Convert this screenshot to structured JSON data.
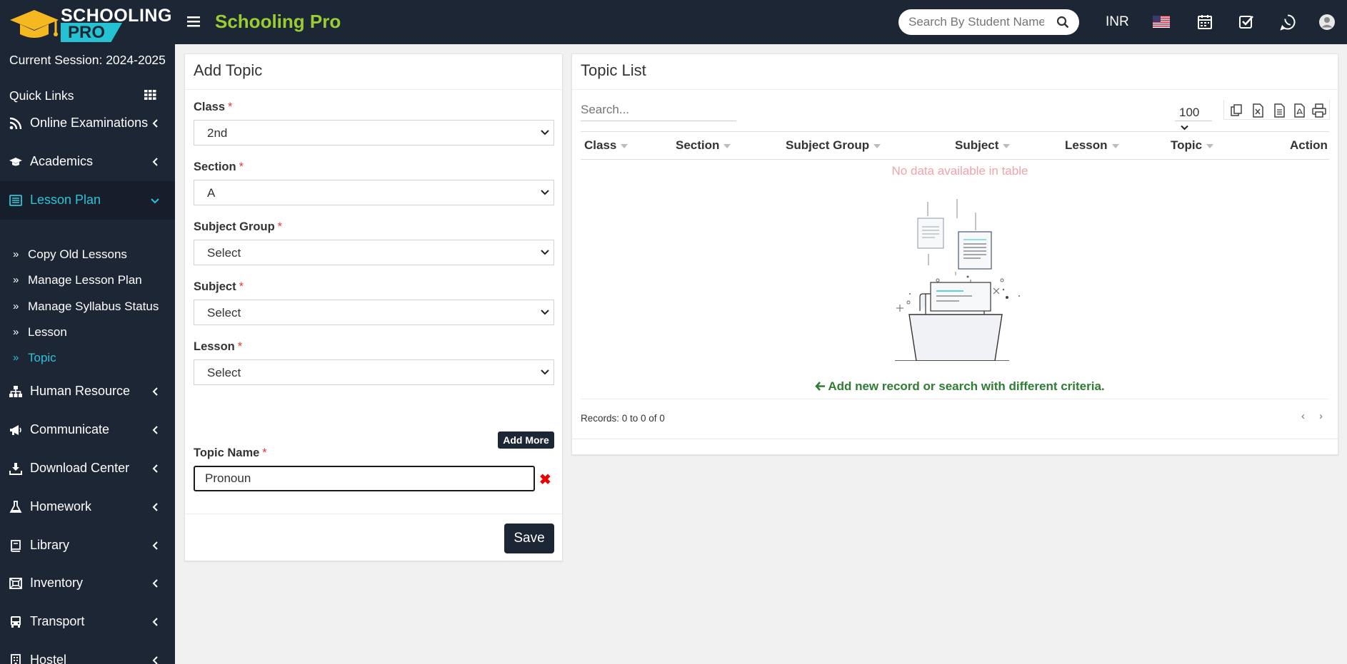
{
  "header": {
    "logo_line1": "SCHOOLING",
    "logo_line2": "PRO",
    "app_name": "Schooling Pro",
    "search_placeholder": "Search By Student Name",
    "currency": "INR"
  },
  "sidebar": {
    "session": "Current Session: 2024-2025",
    "quick_links": "Quick Links",
    "items": [
      {
        "label": "Online Examinations",
        "icon": "rss-icon"
      },
      {
        "label": "Academics",
        "icon": "graduation-cap-icon"
      },
      {
        "label": "Lesson Plan",
        "icon": "list-icon",
        "active": true
      },
      {
        "label": "Human Resource",
        "icon": "sitemap-icon"
      },
      {
        "label": "Communicate",
        "icon": "bullhorn-icon"
      },
      {
        "label": "Download Center",
        "icon": "download-icon"
      },
      {
        "label": "Homework",
        "icon": "flask-icon"
      },
      {
        "label": "Library",
        "icon": "book-icon"
      },
      {
        "label": "Inventory",
        "icon": "box-icon"
      },
      {
        "label": "Transport",
        "icon": "bus-icon"
      },
      {
        "label": "Hostel",
        "icon": "building-icon"
      }
    ],
    "sub_items": [
      {
        "label": "Copy Old Lessons"
      },
      {
        "label": "Manage Lesson Plan"
      },
      {
        "label": "Manage Syllabus Status"
      },
      {
        "label": "Lesson"
      },
      {
        "label": "Topic",
        "active": true
      }
    ]
  },
  "add_topic": {
    "title": "Add Topic",
    "fields": [
      {
        "label": "Class",
        "value": "2nd"
      },
      {
        "label": "Section",
        "value": "A"
      },
      {
        "label": "Subject Group",
        "value": "Select"
      },
      {
        "label": "Subject",
        "value": "Select"
      },
      {
        "label": "Lesson",
        "value": "Select"
      }
    ],
    "required_mark": "*",
    "add_more_label": "Add More",
    "topic_name_label": "Topic Name",
    "topic_name_value": "Pronoun",
    "save_label": "Save"
  },
  "topic_list": {
    "title": "Topic List",
    "search_placeholder": "Search...",
    "page_length": "100",
    "columns": [
      "Class",
      "Section",
      "Subject Group",
      "Subject",
      "Lesson",
      "Topic",
      "Action"
    ],
    "no_data": "No data available in table",
    "add_new_hint": "Add new record or search with different criteria.",
    "records": "Records: 0 to 0 of 0"
  },
  "colors": {
    "dark_navy": "#1d2635",
    "accent_teal": "#2ec2d6",
    "brand_green": "#9acd32",
    "required_red": "#e23a3a"
  }
}
